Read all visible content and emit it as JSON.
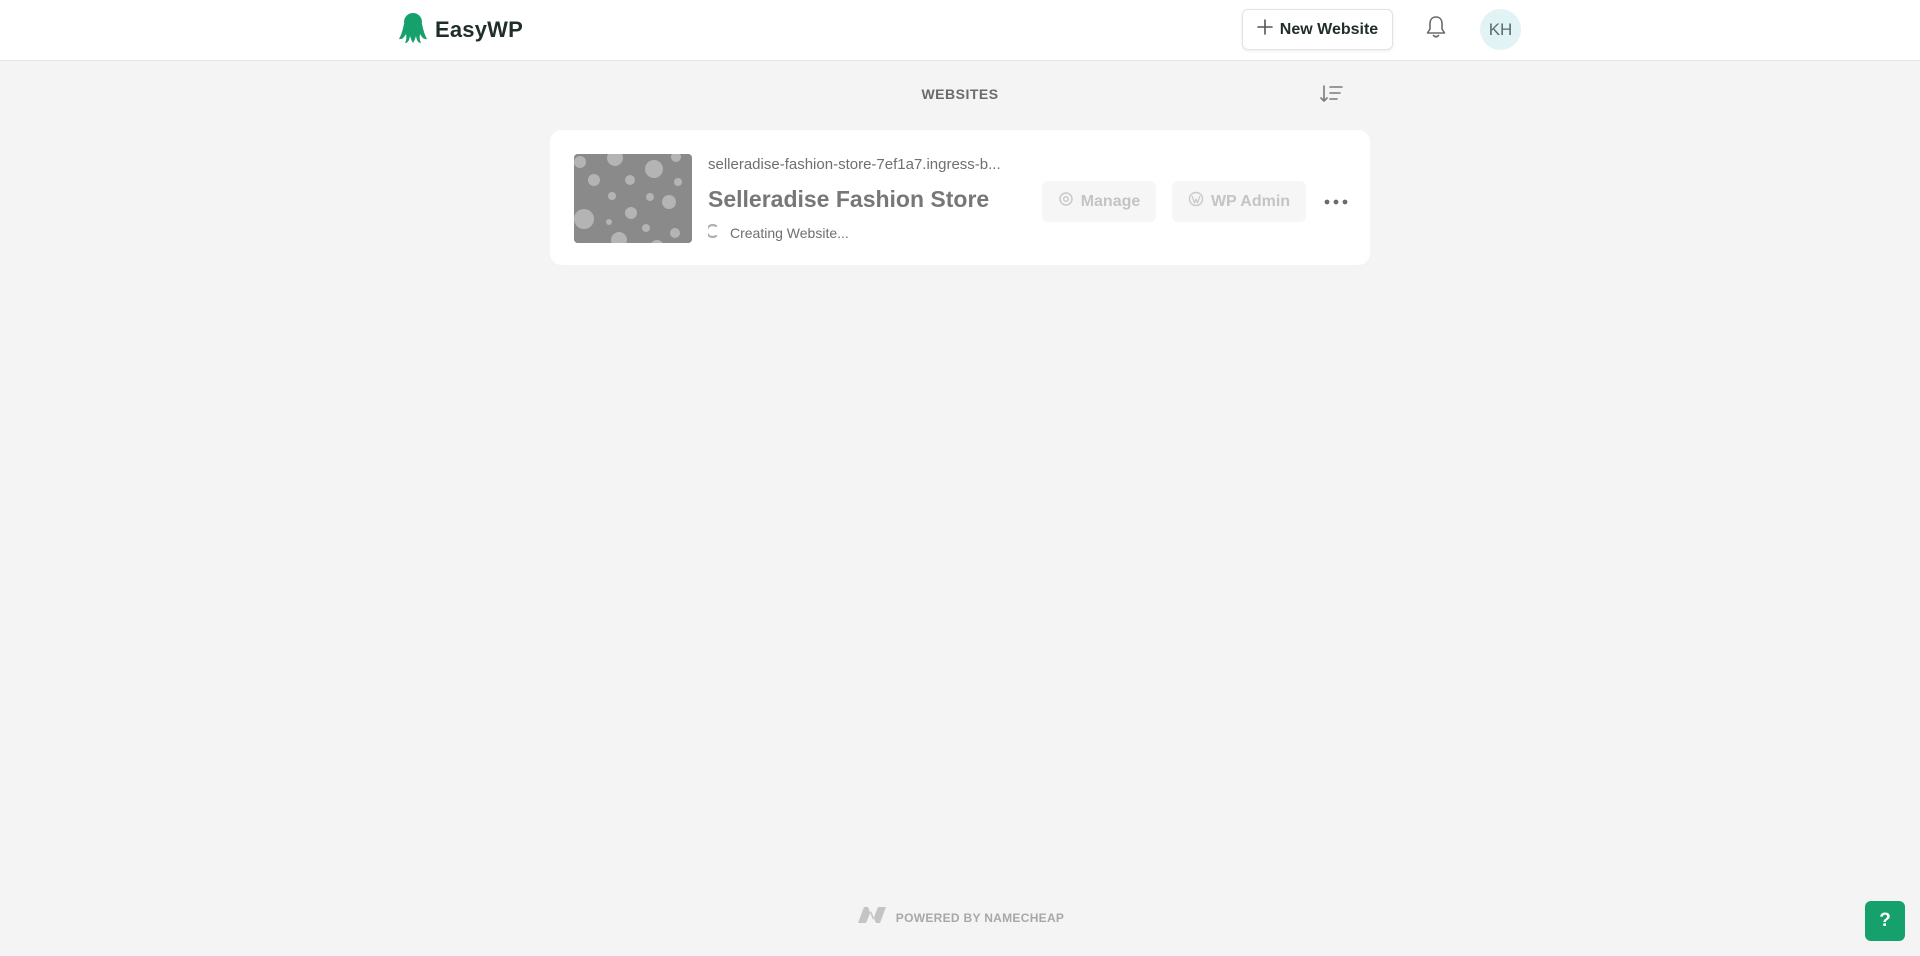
{
  "header": {
    "brand_name": "EasyWP",
    "new_website_label": "New Website",
    "avatar_initials": "KH",
    "brand_color": "#16a06c"
  },
  "websites_section": {
    "title": "WEBSITES"
  },
  "website_card": {
    "url": "selleradise-fashion-store-7ef1a7.ingress-b...",
    "name": "Selleradise Fashion Store",
    "status": "Creating Website...",
    "manage_label": "Manage",
    "wp_admin_label": "WP Admin"
  },
  "footer": {
    "powered_by": "POWERED BY NAMECHEAP"
  },
  "help": {
    "label": "?"
  },
  "icons": {
    "brand": "octopus-logo-icon",
    "new_website": "plus-icon",
    "notifications": "bell-icon",
    "sort": "sort-icon",
    "status": "spinner-icon",
    "manage": "gear-icon",
    "wp_admin": "wordpress-icon",
    "more": "more-icon",
    "footer": "namecheap-logo-icon"
  }
}
